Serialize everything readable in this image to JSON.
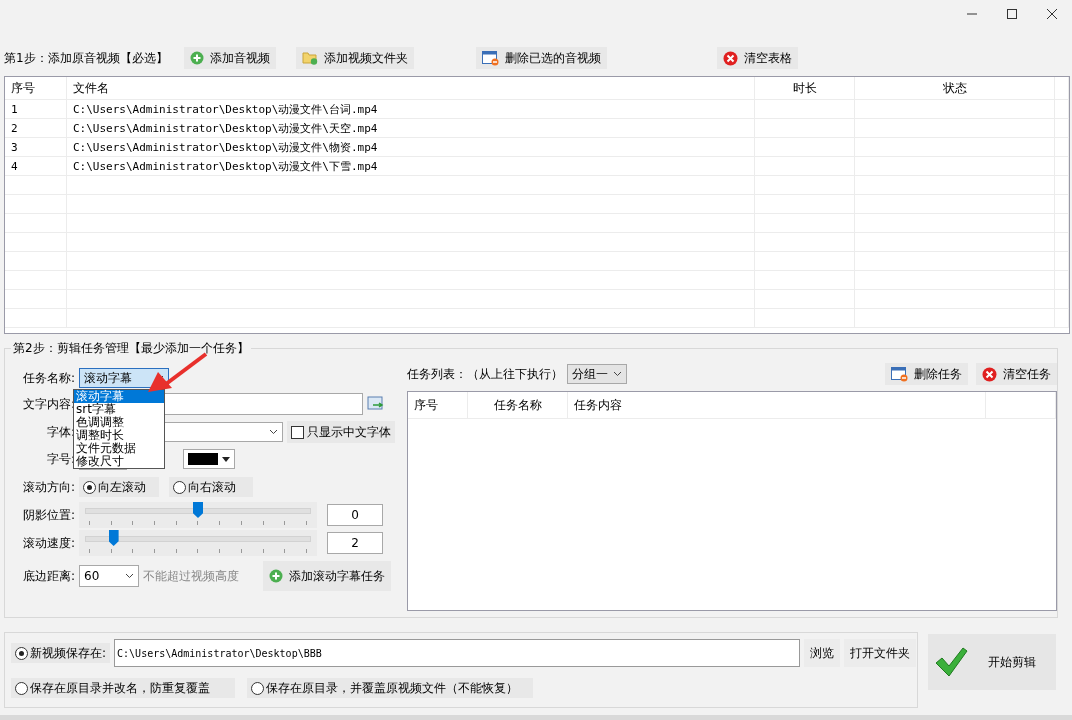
{
  "step1": {
    "title": "第1步：添加原音视频【必选】",
    "buttons": [
      {
        "label": "添加音视频",
        "kind": "add"
      },
      {
        "label": "添加视频文件夹",
        "kind": "folder"
      },
      {
        "label": "删除已选的音视频",
        "kind": "delete"
      },
      {
        "label": "清空表格",
        "kind": "clear"
      }
    ]
  },
  "file_table": {
    "columns": [
      "序号",
      "文件名",
      "时长",
      "状态"
    ],
    "rows": [
      {
        "index": "1",
        "file": "C:\\Users\\Administrator\\Desktop\\动漫文件\\台词.mp4"
      },
      {
        "index": "2",
        "file": "C:\\Users\\Administrator\\Desktop\\动漫文件\\天空.mp4"
      },
      {
        "index": "3",
        "file": "C:\\Users\\Administrator\\Desktop\\动漫文件\\物资.mp4"
      },
      {
        "index": "4",
        "file": "C:\\Users\\Administrator\\Desktop\\动漫文件\\下雪.mp4"
      }
    ]
  },
  "step2": {
    "title": "第2步：剪辑任务管理【最少添加一个任务】",
    "task_name": {
      "label": "任务名称:",
      "value": "滚动字幕",
      "options": [
        {
          "label": "滚动字幕",
          "selected": true
        },
        {
          "label": "srt字幕",
          "selected": false
        },
        {
          "label": "色调调整",
          "selected": false
        },
        {
          "label": "调整时长",
          "selected": false
        },
        {
          "label": "文件元数据",
          "selected": false
        },
        {
          "label": "修改尺寸",
          "selected": false
        }
      ]
    },
    "text_content": {
      "label": "文字内容:"
    },
    "font": {
      "label": "字体:",
      "checkbox": {
        "label": "只显示中文字体",
        "checked": false
      }
    },
    "size": {
      "label": "字号:",
      "color": "#000000"
    },
    "direction": {
      "label": "滚动方向:",
      "options": [
        {
          "label": "向左滚动",
          "selected": true
        },
        {
          "label": "向右滚动",
          "selected": false
        }
      ]
    },
    "sliders": [
      {
        "label": "阴影位置:",
        "level": 0.5,
        "value": "0"
      },
      {
        "label": "滚动速度:",
        "level": 0.12,
        "value": "2"
      }
    ],
    "bottom_distance": {
      "label": "底边距离:",
      "value": "60",
      "hint": "不能超过视频高度"
    },
    "add_button": "添加滚动字幕任务"
  },
  "task_list": {
    "label": "任务列表：（从上往下执行）",
    "group": "分组一",
    "buttons": [
      {
        "label": "删除任务",
        "kind": "delete"
      },
      {
        "label": "清空任务",
        "kind": "clear"
      }
    ],
    "columns": [
      "序号",
      "任务名称",
      "任务内容"
    ]
  },
  "save": {
    "options": [
      {
        "label": "新视频保存在:",
        "selected": true
      },
      {
        "label": "保存在原目录并改名，防重复覆盖",
        "selected": false
      },
      {
        "label": "保存在原目录，并覆盖原视频文件（不能恢复）",
        "selected": false
      }
    ],
    "path": "C:\\Users\\Administrator\\Desktop\\BBB",
    "browse": "浏览",
    "open_folder": "打开文件夹"
  },
  "start_button": "开始剪辑"
}
